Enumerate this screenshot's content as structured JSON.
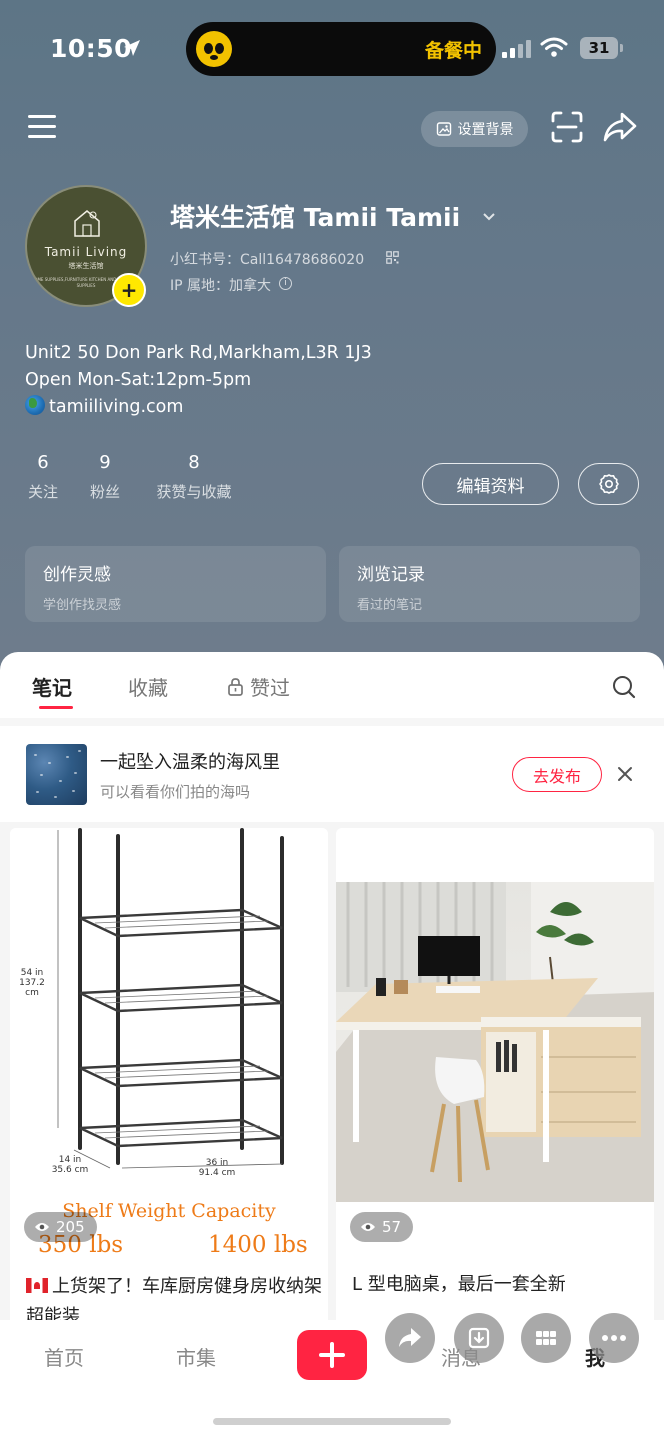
{
  "status_bar": {
    "time": "10:50",
    "activity": "备餐中",
    "battery": "31"
  },
  "top_bar": {
    "set_background_label": "设置背景"
  },
  "profile": {
    "avatar": {
      "brand": "Tamii Living",
      "sub": "塔米生活馆",
      "tagline": "HOME SUPPLIES,FURNITURE KITCHEN AND BATHROOM SUPPLIES"
    },
    "name": "塔米生活馆 Tamii Tamii",
    "red_id": "小红书号：Call16478686020",
    "ip_location": "IP 属地：加拿大",
    "bio": {
      "address": "Unit2 50 Don Park Rd,Markham,L3R 1J3",
      "hours": "Open Mon-Sat:12pm-5pm",
      "website": "tamiiliving.com"
    },
    "stats": [
      {
        "value": "6",
        "label": "关注"
      },
      {
        "value": "9",
        "label": "粉丝"
      },
      {
        "value": "8",
        "label": "获赞与收藏"
      }
    ],
    "edit_label": "编辑资料",
    "cards": [
      {
        "title": "创作灵感",
        "subtitle": "学创作找灵感"
      },
      {
        "title": "浏览记录",
        "subtitle": "看过的笔记"
      }
    ]
  },
  "tabs": [
    {
      "label": "笔记",
      "active": true
    },
    {
      "label": "收藏",
      "active": false
    },
    {
      "label": "赞过",
      "active": false
    }
  ],
  "prompt": {
    "title": "一起坠入温柔的海风里",
    "subtitle": "可以看看你们拍的海吗",
    "publish_label": "去发布"
  },
  "notes": [
    {
      "title": "上货架了！车库厨房健身房收纳架超能装",
      "views": "205",
      "image": {
        "height_label_in": "54 in",
        "height_label_cm": "137.2 cm",
        "depth_label_in": "14 in",
        "depth_label_cm": "35.6 cm",
        "width_label_in": "36 in",
        "width_label_cm": "91.4 cm",
        "caption_title": "Shelf Weight Capacity",
        "caption_left": "350 lbs",
        "caption_right": "1400 lbs"
      }
    },
    {
      "title": "L 型电脑桌，最后一套全新",
      "views": "57"
    }
  ],
  "bottom_nav": [
    {
      "label": "首页"
    },
    {
      "label": "市集"
    },
    {
      "label": "消息"
    },
    {
      "label": "我"
    }
  ],
  "colors": {
    "accent": "#ff2442",
    "header_bg": "#65788a",
    "badge_yellow": "#ffe800"
  }
}
